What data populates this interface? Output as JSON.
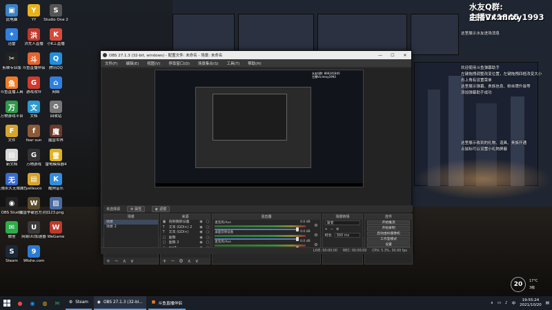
{
  "overlay": {
    "line1": "水友Q群: 866241845",
    "line2": "主播Vx:mrxy1993",
    "notes": [
      "这里展示水友进场消息",
      "欢迎使用斗鱼弹幕助手",
      "左键拖拽调整改变位置，左键拖拽四框改变大小",
      "右上角有设置菜单",
      "这里展示弹幕、贵族信息、粉丝牌升级等",
      "添加弹幕助手成功",
      "这里展示收到的礼物、道具、贵族开通",
      "点鼠标可以设置小礼物屏蔽"
    ]
  },
  "desktop_icons": [
    {
      "label": "此电脑",
      "glyph": "▣",
      "color": "#3b82c4"
    },
    {
      "label": "YY",
      "glyph": "Y",
      "color": "#e8b31c"
    },
    {
      "label": "Studio One 2",
      "glyph": "S",
      "color": "#555555"
    },
    {
      "label": "迅雷",
      "glyph": "✦",
      "color": "#2f7fe0"
    },
    {
      "label": "洪荒人直播",
      "glyph": "洪",
      "color": "#c0392b"
    },
    {
      "label": "小K工直播",
      "glyph": "K",
      "color": "#d64a3a"
    },
    {
      "label": "剪映专业版",
      "glyph": "✂",
      "color": "#222222"
    },
    {
      "label": "斗鱼直播伴侣",
      "glyph": "斗",
      "color": "#e8642c"
    },
    {
      "label": "腾讯QQ",
      "glyph": "Q",
      "color": "#1f8fe0"
    },
    {
      "label": "斗鱼直播工具",
      "glyph": "鱼",
      "color": "#f07b24"
    },
    {
      "label": "游戏攻坪",
      "glyph": "G",
      "color": "#d03a2c"
    },
    {
      "label": "网络",
      "glyph": "⌂",
      "color": "#2f7fe0"
    },
    {
      "label": "万物游戏平台",
      "glyph": "万",
      "color": "#2c9a4a"
    },
    {
      "label": "文档",
      "glyph": "文",
      "color": "#2c9ad0"
    },
    {
      "label": "回收站",
      "glyph": "♻",
      "color": "#777777"
    },
    {
      "label": "文件",
      "glyph": "F",
      "color": "#d7a42c"
    },
    {
      "label": "fear sun",
      "glyph": "f",
      "color": "#8a5a3a"
    },
    {
      "label": "魔兽世界",
      "glyph": "魔",
      "color": "#6a3a2a"
    },
    {
      "label": "新文档",
      "glyph": "▤",
      "color": "#d9d9d9"
    },
    {
      "label": "万物游戏",
      "glyph": "G",
      "color": "#333333"
    },
    {
      "label": "雷电模拟器4",
      "glyph": "雷",
      "color": "#e0b21c"
    },
    {
      "label": "无限永久无限属性",
      "glyph": "无",
      "color": "#3a6ad0"
    },
    {
      "label": "yelleuco",
      "glyph": "▤",
      "color": "#d7a42c"
    },
    {
      "label": "酷狗音乐",
      "glyph": "K",
      "color": "#2f8fe0"
    },
    {
      "label": "OBS Studio",
      "glyph": "◉",
      "color": "#222222"
    },
    {
      "label": "魔兽争霸官方对战平台",
      "glyph": "W",
      "color": "#5a4a2a"
    },
    {
      "label": "123.png",
      "glyph": "▨",
      "color": "#4a6aa0"
    },
    {
      "label": "微信",
      "glyph": "✉",
      "color": "#2cad48"
    },
    {
      "label": "网易UU加速器",
      "glyph": "U",
      "color": "#3a3a3a"
    },
    {
      "label": "WeGame",
      "glyph": "W",
      "color": "#c0392b"
    },
    {
      "label": "Steam",
      "glyph": "S",
      "color": "#1b2838"
    },
    {
      "label": "9Rshe.com",
      "glyph": "9",
      "color": "#2c7ad0"
    }
  ],
  "obs": {
    "title": "OBS 27.1.3 (32-bit, windows) - 配置文件: 未命名 - 场景: 未命名",
    "menu": [
      "文件(F)",
      "编辑(E)",
      "视图(V)",
      "停靠窗口(D)",
      "场景集合(S)",
      "工具(T)",
      "帮助(H)"
    ],
    "nested_text": [
      "水友Q群: 866241845",
      "主播Vx:mrxy1993"
    ],
    "scene_status": "未选择源",
    "prop_btn": "属性",
    "filter_btn": "滤镜",
    "scenes_header": "场景",
    "scenes": [
      "场景",
      "场景 2"
    ],
    "sources_header": "来源",
    "sources": [
      {
        "glyph": "▣",
        "name": "视频捕获设备"
      },
      {
        "glyph": "T",
        "name": "文本 (GDI+) 2"
      },
      {
        "glyph": "T",
        "name": "文本 (GDI+)"
      },
      {
        "glyph": "▢",
        "name": "图像"
      },
      {
        "glyph": "▢",
        "name": "图像 2"
      },
      {
        "glyph": "♪",
        "name": "mp3"
      }
    ],
    "mixer_header": "混音器",
    "mixer": [
      {
        "name": "麦克风/Aux",
        "db": "0.0 dB"
      },
      {
        "name": "桌面音频设备",
        "db": "0.0 dB"
      },
      {
        "name": "麦克风/Aux",
        "db": "0.0 dB"
      }
    ],
    "transitions_header": "场景转场",
    "transition": "渐变",
    "duration_label": "时长",
    "duration": "300 ms",
    "controls_header": "控件",
    "controls": [
      "开始推流",
      "开始录制",
      "启动虚拟摄像机",
      "工作室模式",
      "设置",
      "退出"
    ],
    "status": {
      "live": "LIVE: 00:00:00",
      "rec": "REC: 00:00:00",
      "cpu": "CPU: 5.3%, 30.00 fps"
    }
  },
  "weather": {
    "temp": "20",
    "r1": "17°C",
    "r2": "3级"
  },
  "taskbar": {
    "tasks": [
      "Steam",
      "OBS 27.1.3 (32-bi...",
      "斗鱼直播伴侣"
    ],
    "tray_lang": "中",
    "time": "19:55:24",
    "date": "2021/10/20"
  }
}
